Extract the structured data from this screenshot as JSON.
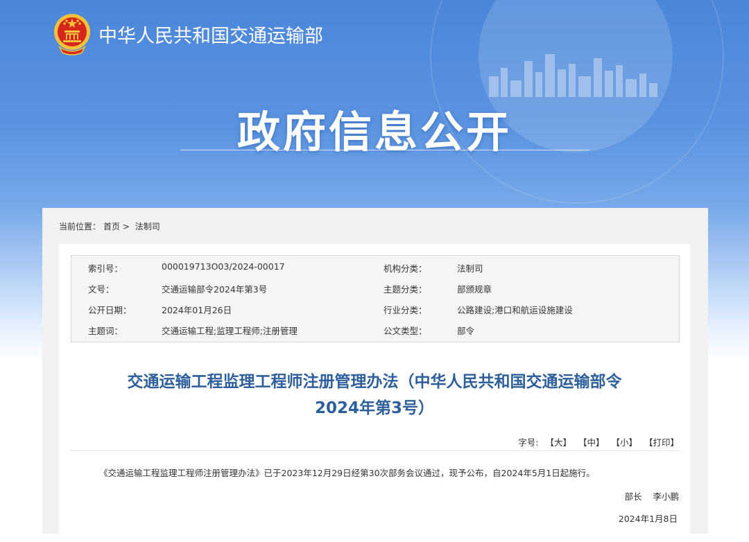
{
  "header": {
    "org_name": "中华人民共和国交通运输部"
  },
  "banner": {
    "title": "政府信息公开"
  },
  "breadcrumb": {
    "label": "当前位置：",
    "home": "首页",
    "sep": ">",
    "current": "法制司"
  },
  "meta": [
    {
      "k1": "索引号：",
      "v1": "000019713O03/2024-00017",
      "k2": "机构分类：",
      "v2": "法制司"
    },
    {
      "k1": "文号：",
      "v1": "交通运输部令2024年第3号",
      "k2": "主题分类：",
      "v2": "部颁规章"
    },
    {
      "k1": "公开日期：",
      "v1": "2024年01月26日",
      "k2": "行业分类：",
      "v2": "公路建设;港口和航运设施建设"
    },
    {
      "k1": "主题词：",
      "v1": "交通运输工程;监理工程师;注册管理",
      "k2": "公文类型：",
      "v2": "部令"
    }
  ],
  "document": {
    "title_line1": "交通运输工程监理工程师注册管理办法（中华人民共和国交通运输部令",
    "title_line2": "2024年第3号）",
    "font_size_label": "字号:",
    "controls": {
      "large": "【大】",
      "medium": "【中】",
      "small": "【小】",
      "print": "【打印】"
    },
    "body": "《交通运输工程监理工程师注册管理办法》已于2023年12月29日经第30次部务会议通过，现予公布，自2024年5月1日起施行。",
    "signer_title": "部长",
    "signer_name": "李小鹏",
    "date": "2024年1月8日"
  },
  "colors": {
    "banner_blue": "#4b86d8",
    "title_blue": "#2d5f9a",
    "emblem_red": "#d7261e",
    "emblem_gold": "#f5c33b"
  }
}
